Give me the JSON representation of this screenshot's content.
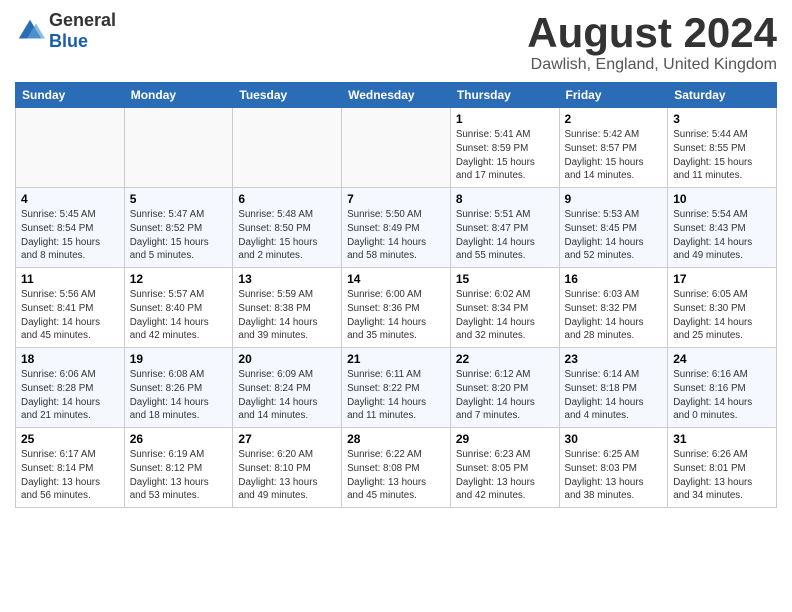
{
  "header": {
    "logo_general": "General",
    "logo_blue": "Blue",
    "month_title": "August 2024",
    "location": "Dawlish, England, United Kingdom"
  },
  "weekdays": [
    "Sunday",
    "Monday",
    "Tuesday",
    "Wednesday",
    "Thursday",
    "Friday",
    "Saturday"
  ],
  "weeks": [
    [
      {
        "day": "",
        "info": ""
      },
      {
        "day": "",
        "info": ""
      },
      {
        "day": "",
        "info": ""
      },
      {
        "day": "",
        "info": ""
      },
      {
        "day": "1",
        "info": "Sunrise: 5:41 AM\nSunset: 8:59 PM\nDaylight: 15 hours and 17 minutes."
      },
      {
        "day": "2",
        "info": "Sunrise: 5:42 AM\nSunset: 8:57 PM\nDaylight: 15 hours and 14 minutes."
      },
      {
        "day": "3",
        "info": "Sunrise: 5:44 AM\nSunset: 8:55 PM\nDaylight: 15 hours and 11 minutes."
      }
    ],
    [
      {
        "day": "4",
        "info": "Sunrise: 5:45 AM\nSunset: 8:54 PM\nDaylight: 15 hours and 8 minutes."
      },
      {
        "day": "5",
        "info": "Sunrise: 5:47 AM\nSunset: 8:52 PM\nDaylight: 15 hours and 5 minutes."
      },
      {
        "day": "6",
        "info": "Sunrise: 5:48 AM\nSunset: 8:50 PM\nDaylight: 15 hours and 2 minutes."
      },
      {
        "day": "7",
        "info": "Sunrise: 5:50 AM\nSunset: 8:49 PM\nDaylight: 14 hours and 58 minutes."
      },
      {
        "day": "8",
        "info": "Sunrise: 5:51 AM\nSunset: 8:47 PM\nDaylight: 14 hours and 55 minutes."
      },
      {
        "day": "9",
        "info": "Sunrise: 5:53 AM\nSunset: 8:45 PM\nDaylight: 14 hours and 52 minutes."
      },
      {
        "day": "10",
        "info": "Sunrise: 5:54 AM\nSunset: 8:43 PM\nDaylight: 14 hours and 49 minutes."
      }
    ],
    [
      {
        "day": "11",
        "info": "Sunrise: 5:56 AM\nSunset: 8:41 PM\nDaylight: 14 hours and 45 minutes."
      },
      {
        "day": "12",
        "info": "Sunrise: 5:57 AM\nSunset: 8:40 PM\nDaylight: 14 hours and 42 minutes."
      },
      {
        "day": "13",
        "info": "Sunrise: 5:59 AM\nSunset: 8:38 PM\nDaylight: 14 hours and 39 minutes."
      },
      {
        "day": "14",
        "info": "Sunrise: 6:00 AM\nSunset: 8:36 PM\nDaylight: 14 hours and 35 minutes."
      },
      {
        "day": "15",
        "info": "Sunrise: 6:02 AM\nSunset: 8:34 PM\nDaylight: 14 hours and 32 minutes."
      },
      {
        "day": "16",
        "info": "Sunrise: 6:03 AM\nSunset: 8:32 PM\nDaylight: 14 hours and 28 minutes."
      },
      {
        "day": "17",
        "info": "Sunrise: 6:05 AM\nSunset: 8:30 PM\nDaylight: 14 hours and 25 minutes."
      }
    ],
    [
      {
        "day": "18",
        "info": "Sunrise: 6:06 AM\nSunset: 8:28 PM\nDaylight: 14 hours and 21 minutes."
      },
      {
        "day": "19",
        "info": "Sunrise: 6:08 AM\nSunset: 8:26 PM\nDaylight: 14 hours and 18 minutes."
      },
      {
        "day": "20",
        "info": "Sunrise: 6:09 AM\nSunset: 8:24 PM\nDaylight: 14 hours and 14 minutes."
      },
      {
        "day": "21",
        "info": "Sunrise: 6:11 AM\nSunset: 8:22 PM\nDaylight: 14 hours and 11 minutes."
      },
      {
        "day": "22",
        "info": "Sunrise: 6:12 AM\nSunset: 8:20 PM\nDaylight: 14 hours and 7 minutes."
      },
      {
        "day": "23",
        "info": "Sunrise: 6:14 AM\nSunset: 8:18 PM\nDaylight: 14 hours and 4 minutes."
      },
      {
        "day": "24",
        "info": "Sunrise: 6:16 AM\nSunset: 8:16 PM\nDaylight: 14 hours and 0 minutes."
      }
    ],
    [
      {
        "day": "25",
        "info": "Sunrise: 6:17 AM\nSunset: 8:14 PM\nDaylight: 13 hours and 56 minutes."
      },
      {
        "day": "26",
        "info": "Sunrise: 6:19 AM\nSunset: 8:12 PM\nDaylight: 13 hours and 53 minutes."
      },
      {
        "day": "27",
        "info": "Sunrise: 6:20 AM\nSunset: 8:10 PM\nDaylight: 13 hours and 49 minutes."
      },
      {
        "day": "28",
        "info": "Sunrise: 6:22 AM\nSunset: 8:08 PM\nDaylight: 13 hours and 45 minutes."
      },
      {
        "day": "29",
        "info": "Sunrise: 6:23 AM\nSunset: 8:05 PM\nDaylight: 13 hours and 42 minutes."
      },
      {
        "day": "30",
        "info": "Sunrise: 6:25 AM\nSunset: 8:03 PM\nDaylight: 13 hours and 38 minutes."
      },
      {
        "day": "31",
        "info": "Sunrise: 6:26 AM\nSunset: 8:01 PM\nDaylight: 13 hours and 34 minutes."
      }
    ]
  ]
}
